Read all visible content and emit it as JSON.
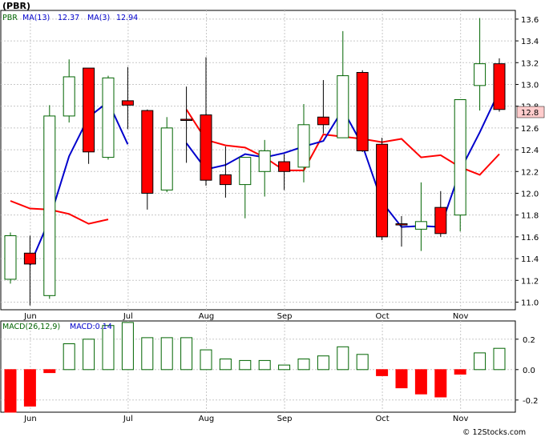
{
  "title": "(PBR)",
  "watermark": "© 12Stocks.com",
  "price_legend": {
    "ticker": "PBR",
    "ma13_label": "MA(13)",
    "ma13_value": "12.37",
    "ma3_label": "MA(3)",
    "ma3_value": "12.94"
  },
  "macd_legend": {
    "label": "MACD(26,12,9)",
    "value_label": "MACD:0.14"
  },
  "last_price_tag": "12.8",
  "colors": {
    "up_candle": "#006400",
    "down_candle": "#ff0000",
    "ma13": "#ff0000",
    "ma3": "#0000cc",
    "macd_positive": "#006400",
    "macd_negative": "#ff0000",
    "price_tag_bg": "#ffcccc"
  },
  "chart_data": [
    {
      "type": "candlestick",
      "ticker": "PBR",
      "x_tick_labels": [
        "Jun",
        "Jul",
        "Aug",
        "Sep",
        "Oct",
        "Nov"
      ],
      "x_tick_index": [
        1,
        6,
        10,
        14,
        19,
        23
      ],
      "y_ticks": [
        "11.0",
        "11.2",
        "11.4",
        "11.6",
        "11.8",
        "12.0",
        "12.2",
        "12.4",
        "12.6",
        "12.8",
        "13.0",
        "13.2",
        "13.4",
        "13.6"
      ],
      "ylim": [
        10.93,
        13.68
      ],
      "grid": true,
      "candles": [
        {
          "o": 11.21,
          "h": 11.64,
          "l": 11.17,
          "c": 11.61
        },
        {
          "o": 11.45,
          "h": 11.61,
          "l": 10.97,
          "c": 11.35
        },
        {
          "o": 11.06,
          "h": 12.81,
          "l": 11.03,
          "c": 12.71
        },
        {
          "o": 12.71,
          "h": 13.23,
          "l": 12.65,
          "c": 13.07
        },
        {
          "o": 13.15,
          "h": 13.15,
          "l": 12.27,
          "c": 12.38
        },
        {
          "o": 12.33,
          "h": 13.08,
          "l": 12.31,
          "c": 13.06
        },
        {
          "o": 12.85,
          "h": 13.16,
          "l": 12.59,
          "c": 12.81
        },
        {
          "o": 12.76,
          "h": 12.77,
          "l": 11.85,
          "c": 12.0
        },
        {
          "o": 12.03,
          "h": 12.7,
          "l": 12.01,
          "c": 12.6
        },
        {
          "o": 12.68,
          "h": 12.98,
          "l": 12.28,
          "c": 12.67
        },
        {
          "o": 12.72,
          "h": 13.25,
          "l": 12.07,
          "c": 12.12
        },
        {
          "o": 12.17,
          "h": 12.43,
          "l": 11.96,
          "c": 12.08
        },
        {
          "o": 12.08,
          "h": 12.33,
          "l": 11.77,
          "c": 12.33
        },
        {
          "o": 12.2,
          "h": 12.49,
          "l": 11.97,
          "c": 12.39
        },
        {
          "o": 12.29,
          "h": 12.36,
          "l": 12.03,
          "c": 12.2
        },
        {
          "o": 12.24,
          "h": 12.82,
          "l": 12.1,
          "c": 12.63
        },
        {
          "o": 12.7,
          "h": 13.04,
          "l": 12.55,
          "c": 12.63
        },
        {
          "o": 12.51,
          "h": 13.49,
          "l": 12.51,
          "c": 13.08
        },
        {
          "o": 13.11,
          "h": 13.13,
          "l": 12.38,
          "c": 12.39
        },
        {
          "o": 12.45,
          "h": 12.51,
          "l": 11.57,
          "c": 11.6
        },
        {
          "o": 11.72,
          "h": 11.79,
          "l": 11.51,
          "c": 11.71
        },
        {
          "o": 11.67,
          "h": 12.1,
          "l": 11.47,
          "c": 11.74
        },
        {
          "o": 11.87,
          "h": 12.02,
          "l": 11.6,
          "c": 11.63
        },
        {
          "o": 11.8,
          "h": 12.86,
          "l": 11.65,
          "c": 12.86
        },
        {
          "o": 12.99,
          "h": 13.61,
          "l": 12.76,
          "c": 13.19
        },
        {
          "o": 13.19,
          "h": 13.24,
          "l": 12.75,
          "c": 12.77
        }
      ],
      "series": [
        {
          "name": "MA(13)",
          "values": [
            11.93,
            11.86,
            11.85,
            11.81,
            11.72,
            11.76,
            null,
            null,
            null,
            12.77,
            12.49,
            12.44,
            12.42,
            12.33,
            12.21,
            12.21,
            12.54,
            12.52,
            12.5,
            12.47,
            12.5,
            12.33,
            12.35,
            12.24,
            12.17,
            12.36
          ]
        },
        {
          "name": "MA(3)",
          "values": [
            null,
            11.34,
            11.76,
            12.34,
            12.7,
            12.84,
            12.45,
            null,
            null,
            12.46,
            12.22,
            12.26,
            12.36,
            12.33,
            12.37,
            12.43,
            12.48,
            12.77,
            12.44,
            11.92,
            11.69,
            11.7,
            11.69,
            12.21,
            12.56,
            12.94
          ]
        }
      ]
    },
    {
      "type": "bar",
      "name": "MACD(26,12,9)",
      "y_ticks": [
        "0.2",
        "0.0",
        "-0.2"
      ],
      "ylim": [
        -0.28,
        0.32
      ],
      "grid": true,
      "values": [
        -0.29,
        -0.24,
        -0.02,
        0.17,
        0.2,
        0.29,
        0.31,
        0.21,
        0.21,
        0.21,
        0.13,
        0.07,
        0.06,
        0.06,
        0.03,
        0.07,
        0.09,
        0.15,
        0.1,
        -0.04,
        -0.12,
        -0.16,
        -0.18,
        -0.03,
        0.11,
        0.14
      ]
    }
  ]
}
